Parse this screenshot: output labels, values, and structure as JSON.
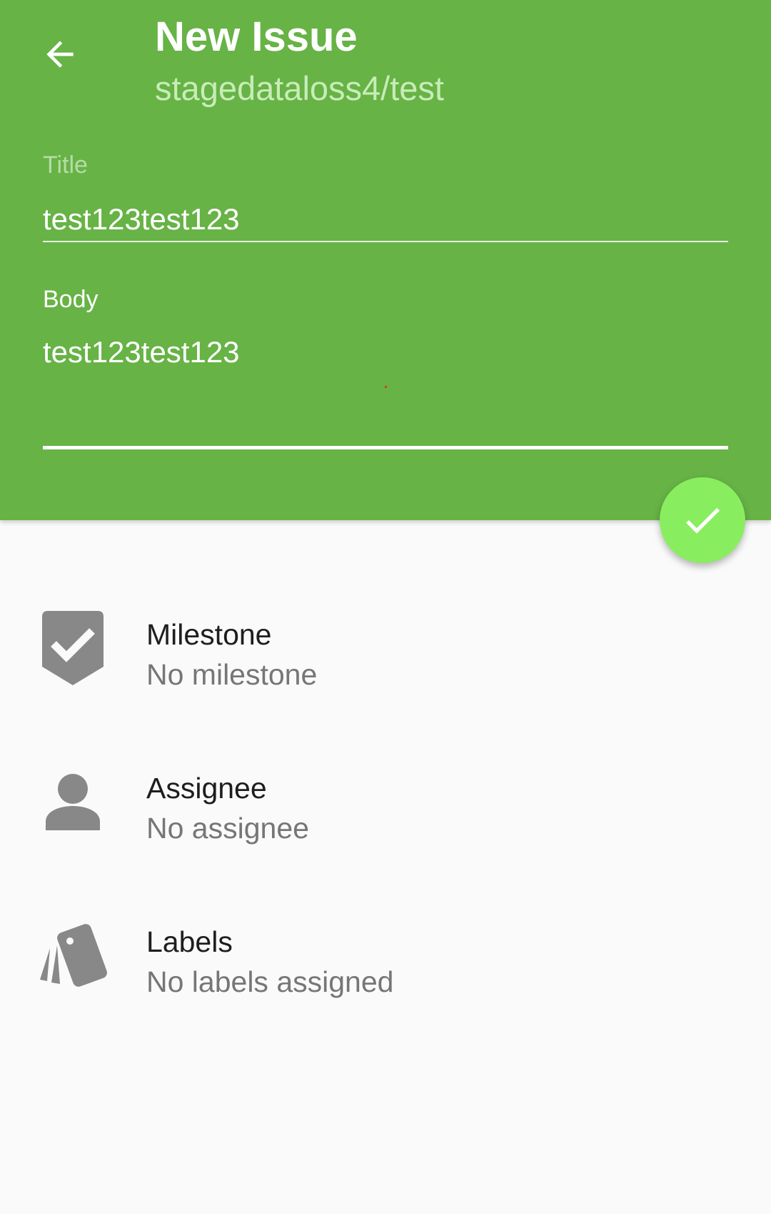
{
  "toolbar": {
    "back_icon": "arrow-left-icon",
    "title": "New Issue",
    "subtitle": "stagedataloss4/test"
  },
  "form": {
    "title_label": "Title",
    "title_value": "test123test123",
    "body_label": "Body",
    "body_value": "test123test123"
  },
  "fab": {
    "icon": "check-icon"
  },
  "options": [
    {
      "icon": "milestone-icon",
      "title": "Milestone",
      "value": "No milestone"
    },
    {
      "icon": "person-icon",
      "title": "Assignee",
      "value": "No assignee"
    },
    {
      "icon": "labels-icon",
      "title": "Labels",
      "value": "No labels assigned"
    }
  ],
  "colors": {
    "header_bg": "#67b346",
    "fab_bg": "#89ee5f",
    "subtitle": "#c8ecb8",
    "icon_gray": "#888888",
    "page_bg": "#fafafa"
  }
}
